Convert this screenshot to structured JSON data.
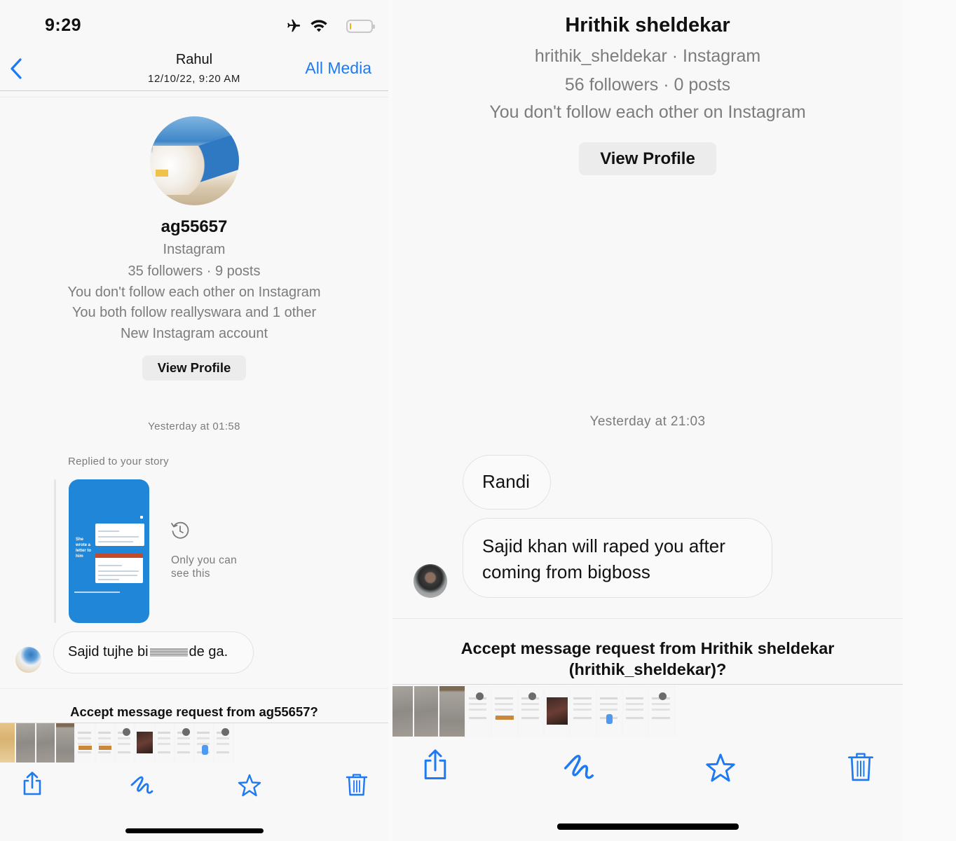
{
  "left": {
    "status_bar": {
      "time": "9:29",
      "icons": [
        "airplane-icon",
        "wifi-icon",
        "battery-icon"
      ]
    },
    "nav": {
      "back_icon": "chevron-left-icon",
      "title": "Rahul",
      "subtitle": "12/10/22, 9:20 AM",
      "all_media_label": "All Media"
    },
    "profile": {
      "username": "ag55657",
      "platform": "Instagram",
      "stats": "35 followers · 9 posts",
      "follow_status": "You don't follow each other on Instagram",
      "mutuals": "You both follow reallyswara and 1 other",
      "account_note": "New Instagram account",
      "view_profile_label": "View Profile"
    },
    "conversation": {
      "timestamp": "Yesterday at 01:58",
      "story_reply_label": "Replied to your story",
      "story_preview_text": "She wrote a letter to him",
      "visibility_note_line1": "Only you can",
      "visibility_note_line2": "see this",
      "message_before_redaction": "Sajid tujhe bi",
      "message_after_redaction": "de ga."
    },
    "accept_prompt": "Accept message request from ag55657?",
    "thumbnail_count": 12
  },
  "right": {
    "profile": {
      "display_name": "Hrithik sheldekar",
      "handle_platform": "hrithik_sheldekar · Instagram",
      "stats": "56 followers · 0 posts",
      "follow_status": "You don't follow each other on Instagram",
      "view_profile_label": "View Profile"
    },
    "conversation": {
      "timestamp": "Yesterday at 21:03",
      "messages": [
        "Randi",
        "Sajid khan will raped you after coming from bigboss"
      ],
      "message2_line1": "Sajid khan will raped you after",
      "message2_line2": "coming from bigboss"
    },
    "accept_prompt_line1": "Accept message request from Hrithik sheldekar",
    "accept_prompt_line2": "(hrithik_sheldekar)?",
    "thumbnail_count": 11
  },
  "toolbar": {
    "buttons": [
      {
        "name": "share",
        "icon": "share-icon"
      },
      {
        "name": "markup",
        "icon": "markup-scribble-icon"
      },
      {
        "name": "favorite",
        "icon": "star-icon"
      },
      {
        "name": "delete",
        "icon": "trash-icon"
      }
    ]
  },
  "colors": {
    "accent": "#1d7af3",
    "text_primary": "#111111",
    "text_secondary": "#7c7c7c",
    "story_card": "#1f86d8",
    "background": "#f8f8f8"
  }
}
